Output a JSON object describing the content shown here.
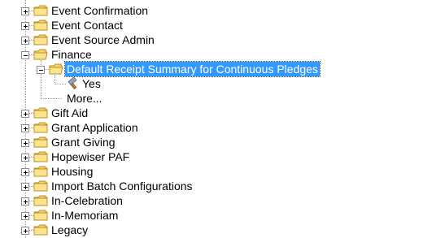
{
  "tree": {
    "items": [
      {
        "label": "Event Confirmation",
        "icon": "folder-icon",
        "expanded": false
      },
      {
        "label": "Event Contact",
        "icon": "folder-icon",
        "expanded": false
      },
      {
        "label": "Event Source Admin",
        "icon": "folder-icon",
        "expanded": false
      },
      {
        "label": "Finance",
        "icon": "folder-open-icon",
        "expanded": true
      },
      {
        "label": "Default Receipt Summary for Continuous Pledges",
        "icon": "folder-open-icon",
        "expanded": true,
        "selected": true
      },
      {
        "label": "Yes",
        "icon": "hammer-icon"
      },
      {
        "label": "More...",
        "icon": ""
      },
      {
        "label": "Gift Aid",
        "icon": "folder-icon",
        "expanded": false
      },
      {
        "label": "Grant Application",
        "icon": "folder-icon",
        "expanded": false
      },
      {
        "label": "Grant Giving",
        "icon": "folder-icon",
        "expanded": false
      },
      {
        "label": "Hopewiser PAF",
        "icon": "folder-icon",
        "expanded": false
      },
      {
        "label": "Housing",
        "icon": "folder-icon",
        "expanded": false
      },
      {
        "label": "Import Batch Configurations",
        "icon": "folder-icon",
        "expanded": false
      },
      {
        "label": "In-Celebration",
        "icon": "folder-icon",
        "expanded": false
      },
      {
        "label": "In-Memoriam",
        "icon": "folder-icon",
        "expanded": false
      },
      {
        "label": "Legacy",
        "icon": "folder-icon",
        "expanded": false
      }
    ]
  },
  "colors": {
    "selection": "#3399ff",
    "folder": "#f2c94c",
    "tree_lines": "#9c9c9c"
  }
}
